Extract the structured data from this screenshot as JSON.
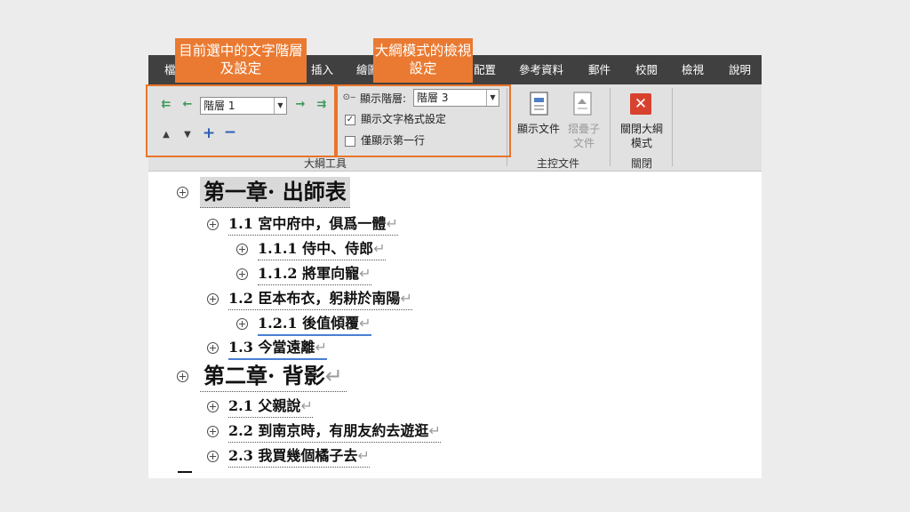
{
  "menu": [
    "檔",
    "插入",
    "繪圖",
    "配置",
    "參考資料",
    "郵件",
    "校閱",
    "檢視",
    "說明"
  ],
  "ribbon": {
    "outline_tools": {
      "level_select": "階層 1",
      "group_label": "大綱工具"
    },
    "show_level": {
      "label": "顯示階層:",
      "value": "階層 3"
    },
    "show_text_formatting": "顯示文字格式設定",
    "show_first_line_only": "僅顯示第一行",
    "master_document": {
      "show_document": "顯示文件",
      "collapse_subdocuments": "摺疊子文件",
      "group_label": "主控文件"
    },
    "close": {
      "button": "關閉大綱模式",
      "group_label": "關閉"
    }
  },
  "callouts": {
    "left": "目前選中的文字階層及設定",
    "right": "大綱模式的檢視設定"
  },
  "outline": [
    {
      "level": 1,
      "num": "第一章",
      "title": "出師表"
    },
    {
      "level": 2,
      "num": "1.1",
      "title": "宮中府中，俱爲一體"
    },
    {
      "level": 3,
      "num": "1.1.1",
      "title": "侍中、侍郎"
    },
    {
      "level": 3,
      "num": "1.1.2",
      "title": "將軍向寵"
    },
    {
      "level": 2,
      "num": "1.2",
      "title": "臣本布衣，躬耕於南陽"
    },
    {
      "level": 3,
      "num": "1.2.1",
      "title": "後值傾覆"
    },
    {
      "level": 2,
      "num": "1.3",
      "title": "今當遠離"
    },
    {
      "level": 1,
      "num": "第二章",
      "title": "背影"
    },
    {
      "level": 2,
      "num": "2.1",
      "title": "父親說"
    },
    {
      "level": 2,
      "num": "2.2",
      "title": "到南京時，有朋友約去遊逛"
    },
    {
      "level": 2,
      "num": "2.3",
      "title": "我買幾個橘子去"
    }
  ],
  "colors": {
    "accent": "#ea7a31",
    "menubar": "#404040",
    "ribbon": "#e1e1e1",
    "close_red": "#d9412f"
  }
}
